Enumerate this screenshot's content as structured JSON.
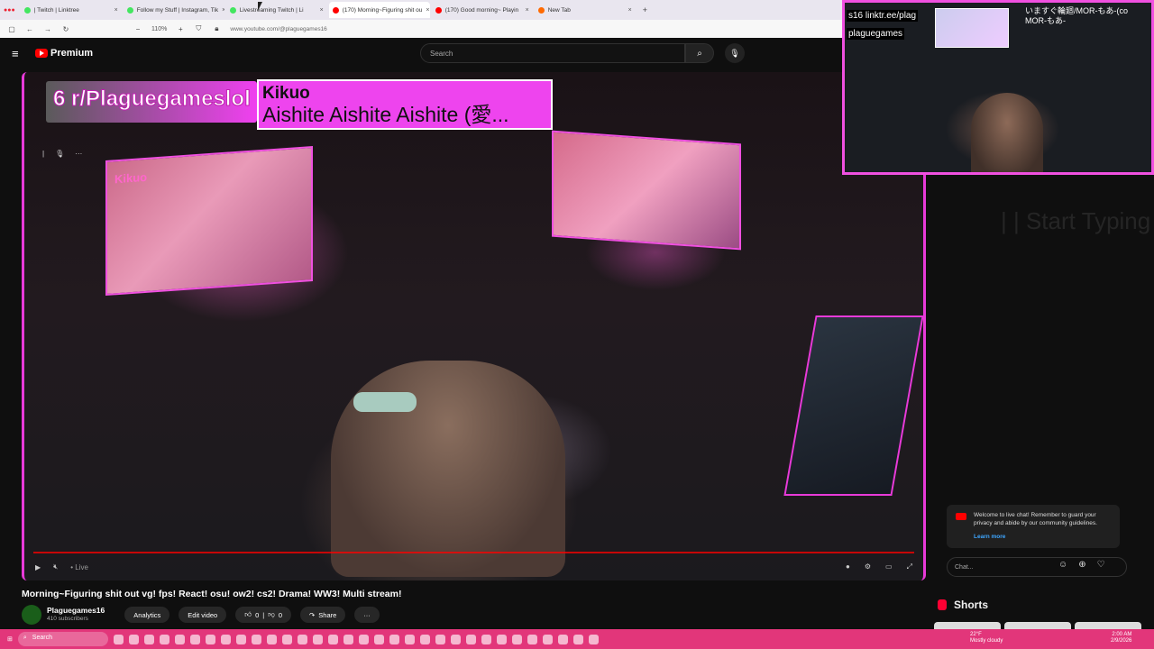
{
  "browser": {
    "tabs": [
      {
        "label": "| Twitch | Linktree",
        "color": "#43e660",
        "active": false
      },
      {
        "label": "Follow my Stuff | Instagram, Tik",
        "color": "#43e660",
        "active": false
      },
      {
        "label": "Livestreaming Twitch | Li",
        "color": "#43e660",
        "active": false
      },
      {
        "label": "(170) Morning~Figuring shit ou",
        "color": "#ff0000",
        "active": true
      },
      {
        "label": "(170) Good morning~ Playin",
        "color": "#ff0000",
        "active": false
      },
      {
        "label": "New Tab",
        "color": "#ff6a00",
        "active": false
      }
    ],
    "newtab": "+",
    "zoom": "110%",
    "url": "www.youtube.com/@plaguegames16"
  },
  "youtube": {
    "logo": "Premium",
    "search_placeholder": "Search"
  },
  "video": {
    "overlay_subreddit": "6 r/Plaguegameslol",
    "song_artist": "Kikuo",
    "song_title": "Aishite Aishite Aishite (愛...",
    "monitor_text": "Kikuo",
    "live_label": "Live",
    "title": "Morning~Figuring shit out vg! fps! React! osu! ow2! cs2! Drama! WW3! Multi stream!"
  },
  "cam": {
    "label1": "s16 linktr.ee/plag",
    "label2": "plaguegames",
    "label3": "いますぐ輪廻/MOR-もあ-(co",
    "label3b": "MOR-もあ-"
  },
  "chat": {
    "ghost": "| | Start Typing",
    "welcome": "Welcome to live chat! Remember to guard your privacy and abide by our community guidelines.",
    "learn_more": "Learn more",
    "placeholder": "Chat..."
  },
  "shorts": {
    "label": "Shorts"
  },
  "channel": {
    "name": "Plaguegames16",
    "subscribers": "410 subscribers",
    "analytics": "Analytics",
    "edit_video": "Edit video",
    "likes": "0",
    "dislikes": "0",
    "share": "Share",
    "more": "···"
  },
  "taskbar": {
    "search": "Search",
    "temp": "22°F",
    "weather": "Mostly cloudy",
    "time": "2:00 AM",
    "date": "2/9/2026"
  },
  "colors": {
    "accent": "#e83ad9",
    "taskbar": "#e2367a",
    "yt_red": "#ff0000"
  }
}
